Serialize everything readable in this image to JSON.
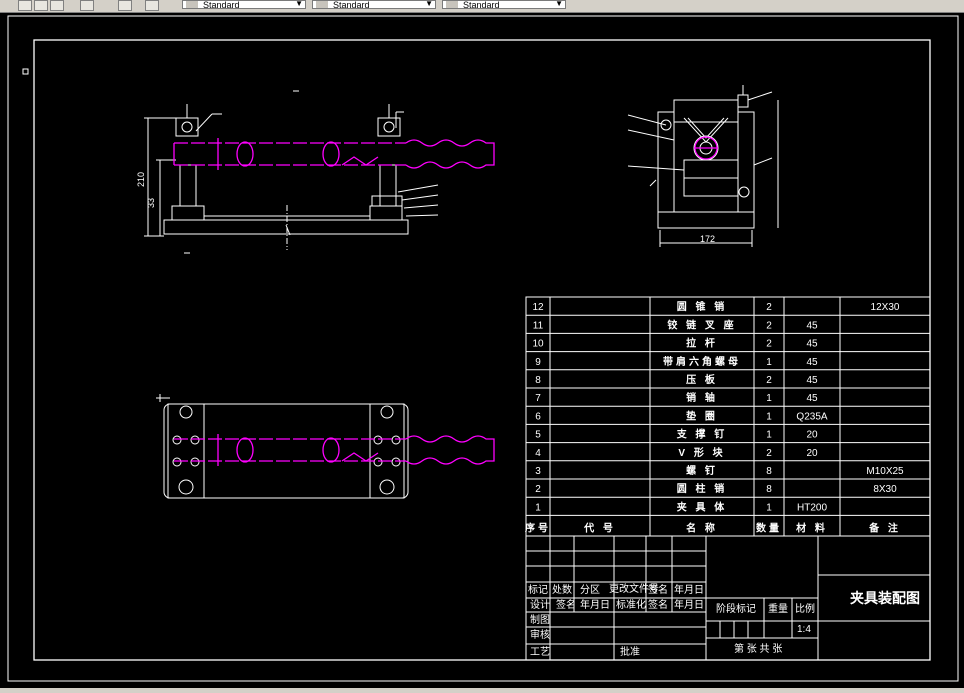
{
  "toolbar": {
    "text_style": "Standard",
    "dim_style": "Standard",
    "table_style": "Standard"
  },
  "views": {
    "front_dims": [
      "210",
      "33"
    ],
    "side_dims": [
      "172"
    ]
  },
  "bom": {
    "rows": [
      {
        "no": "12",
        "name": "圆 锥 销",
        "qty": "2",
        "material": "",
        "note": "12X30"
      },
      {
        "no": "11",
        "name": "铰 链 叉 座",
        "qty": "2",
        "material": "45",
        "note": ""
      },
      {
        "no": "10",
        "name": "拉 杆",
        "qty": "2",
        "material": "45",
        "note": ""
      },
      {
        "no": "9",
        "name": "带肩六角螺母",
        "qty": "1",
        "material": "45",
        "note": ""
      },
      {
        "no": "8",
        "name": "压 板",
        "qty": "2",
        "material": "45",
        "note": ""
      },
      {
        "no": "7",
        "name": "销 轴",
        "qty": "1",
        "material": "45",
        "note": ""
      },
      {
        "no": "6",
        "name": "垫 圈",
        "qty": "1",
        "material": "Q235A",
        "note": ""
      },
      {
        "no": "5",
        "name": "支 撑 钉",
        "qty": "1",
        "material": "20",
        "note": ""
      },
      {
        "no": "4",
        "name": "V 形 块",
        "qty": "2",
        "material": "20",
        "note": ""
      },
      {
        "no": "3",
        "name": "螺 钉",
        "qty": "8",
        "material": "",
        "note": "M10X25"
      },
      {
        "no": "2",
        "name": "圆 柱 销",
        "qty": "8",
        "material": "",
        "note": "8X30"
      },
      {
        "no": "1",
        "name": "夹 具 体",
        "qty": "1",
        "material": "HT200",
        "note": ""
      }
    ],
    "header": {
      "no": "序号",
      "code": "代 号",
      "name": "名 称",
      "qty": "数量",
      "material": "材 料",
      "note": "备 注"
    }
  },
  "title_block": {
    "drawing_title": "夹具装配图",
    "mark": "标记",
    "count": "处数",
    "zone": "分区",
    "change_doc": "更改文件号",
    "sign": "签名",
    "date": "年月日",
    "design": "设计",
    "sign2": "签名",
    "date2": "年月日",
    "standardize": "标准化",
    "sign3": "签名",
    "date3": "年月日",
    "draw": "制图",
    "check": "审核",
    "process": "工艺",
    "approve": "批准",
    "stage_mark": "阶段标记",
    "weight": "重量",
    "scale": "比例",
    "scale_value": "1:4",
    "sheets": "第 张 共 张"
  },
  "colors": {
    "line": "#ffffff",
    "part": "#ff00ff",
    "background": "#000000"
  }
}
